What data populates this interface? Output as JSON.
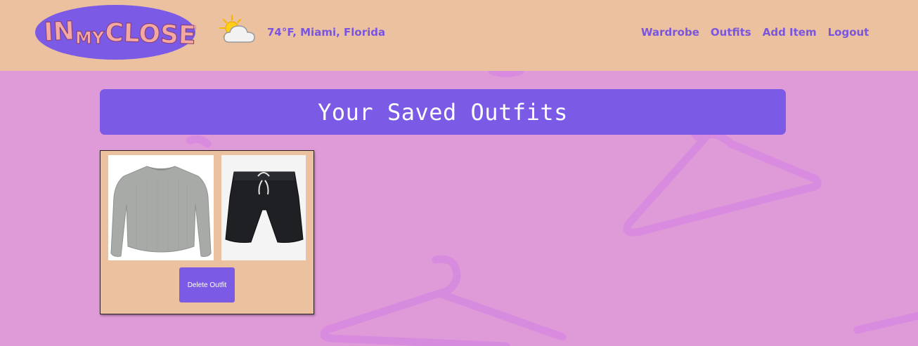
{
  "header": {
    "logo_text": "IN MY CLOSET",
    "weather": {
      "icon": "partly-cloudy-icon",
      "text": "74°F, Miami, Florida"
    },
    "nav": [
      {
        "label": "Wardrobe"
      },
      {
        "label": "Outfits"
      },
      {
        "label": "Add Item"
      },
      {
        "label": "Logout"
      }
    ]
  },
  "main": {
    "title": "Your Saved Outfits",
    "outfits": [
      {
        "items": [
          {
            "icon": "sweater-image"
          },
          {
            "icon": "shorts-image"
          }
        ],
        "delete_label": "Delete Outfit"
      }
    ]
  },
  "colors": {
    "header_bg": "#ecc19f",
    "page_bg": "#df9bd8",
    "accent": "#7b5be6",
    "nav_text": "#7a55dd"
  }
}
